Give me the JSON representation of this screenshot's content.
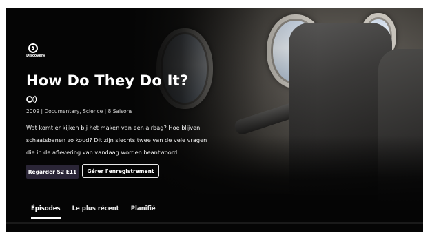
{
  "show": {
    "brand": "Discovery",
    "title": "How Do They Do It?",
    "meta": "2009 | Documentary, Science | 8 Saisons",
    "description": "Wat komt er kijken bij het maken van een airbag? Hoe blijven schaatsbanen zo koud? Dit zijn slechts twee van de vele vragen die in de aflevering van vandaag worden beantwoord."
  },
  "actions": {
    "play_label": "Regarder S2  E11",
    "record_label": "Gérer l'enregistrement"
  },
  "tabs": [
    {
      "label": "Épisodes",
      "active": true
    },
    {
      "label": "Le plus récent",
      "active": false
    },
    {
      "label": "Planifié",
      "active": false
    }
  ],
  "icons": {
    "brand": "discovery-logo-icon",
    "audio": "audio-description-icon"
  },
  "colors": {
    "background": "#050505",
    "play_button": "#2a2536",
    "text": "#ffffff"
  }
}
